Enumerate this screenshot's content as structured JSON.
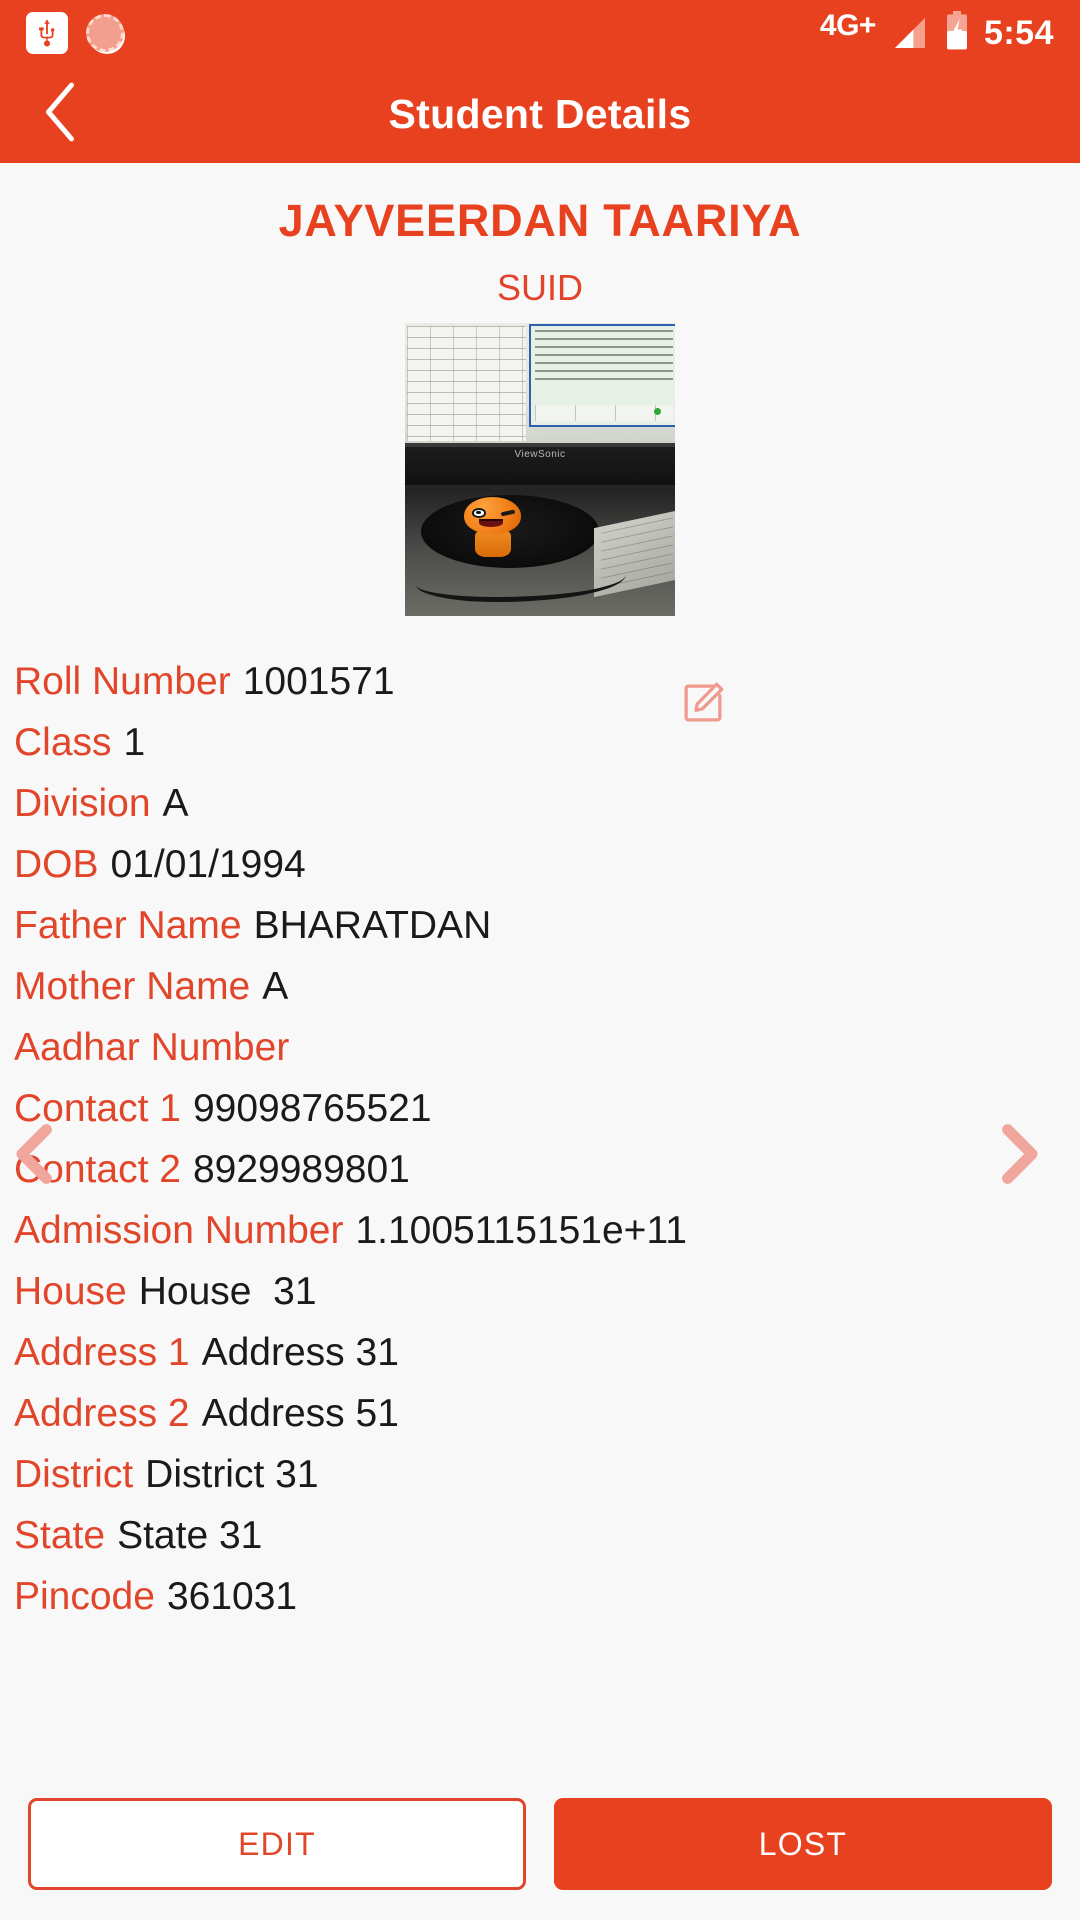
{
  "status_bar": {
    "icons": [
      "usb-icon",
      "sync-spinner-icon"
    ],
    "network_label": "4G+",
    "battery_icon": "battery-charging-icon",
    "signal_icon": "signal-bars-icon",
    "time": "5:54"
  },
  "app_bar": {
    "back_icon": "back-chevron-icon",
    "title": "Student Details"
  },
  "student": {
    "name": "JAYVEERDAN TAARIYA",
    "suid": "SUID",
    "photo_alt": "student-photo",
    "edit_photo_icon": "edit-pencil-icon"
  },
  "details": [
    {
      "label": "Roll Number",
      "value": "1001571"
    },
    {
      "label": "Class",
      "value": "1"
    },
    {
      "label": "Division",
      "value": "A"
    },
    {
      "label": "DOB",
      "value": "01/01/1994"
    },
    {
      "label": "Father Name",
      "value": "BHARATDAN"
    },
    {
      "label": "Mother Name",
      "value": "A"
    },
    {
      "label": "Aadhar Number",
      "value": ""
    },
    {
      "label": "Contact 1",
      "value": "99098765521"
    },
    {
      "label": "Contact 2",
      "value": "8929989801"
    },
    {
      "label": "Admission Number",
      "value": "1.1005115151e+11"
    },
    {
      "label": "House",
      "value": "House  31"
    },
    {
      "label": "Address 1",
      "value": "Address 31"
    },
    {
      "label": "Address 2",
      "value": "Address 51"
    },
    {
      "label": "District",
      "value": "District 31"
    },
    {
      "label": "State",
      "value": "State 31"
    },
    {
      "label": "Pincode",
      "value": "361031"
    }
  ],
  "pager": {
    "prev_icon": "chevron-left-icon",
    "next_icon": "chevron-right-icon"
  },
  "actions": {
    "edit_label": "EDIT",
    "lost_label": "LOST"
  },
  "colors": {
    "primary": "#e8411f",
    "label": "#e2462a",
    "value": "#1a1a1a",
    "background": "#f8f8f8",
    "chevron": "#f0a69c"
  }
}
